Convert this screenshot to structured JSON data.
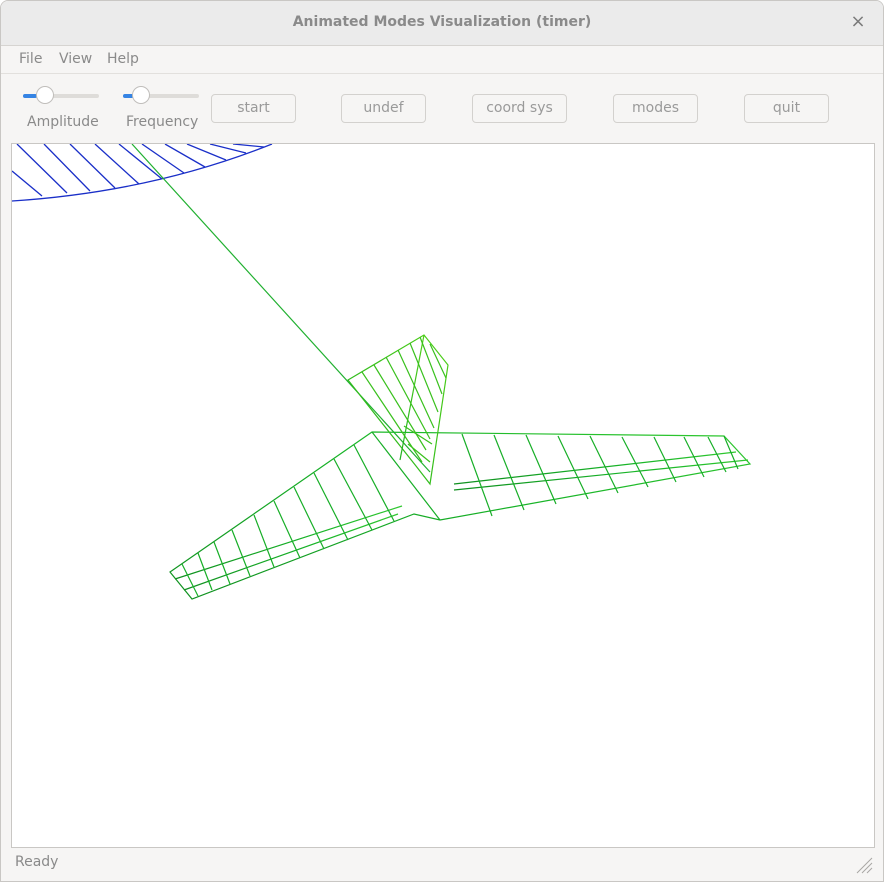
{
  "window": {
    "title": "Animated Modes Visualization (timer)",
    "close_glyph": "×"
  },
  "menu": {
    "items": [
      "File",
      "View",
      "Help"
    ]
  },
  "controls": {
    "amplitude": {
      "label": "Amplitude",
      "value": 0.2
    },
    "frequency": {
      "label": "Frequency",
      "value": 0.2
    },
    "buttons": {
      "start": "start",
      "undef": "undef",
      "coord_sys": "coord sys",
      "modes": "modes",
      "quit": "quit"
    }
  },
  "status": {
    "text": "Ready"
  },
  "colors": {
    "accent": "#3584e4",
    "mesh_blue": "#1a2fc8",
    "mesh_green_dark": "#109020",
    "mesh_green_light": "#40cc20"
  }
}
